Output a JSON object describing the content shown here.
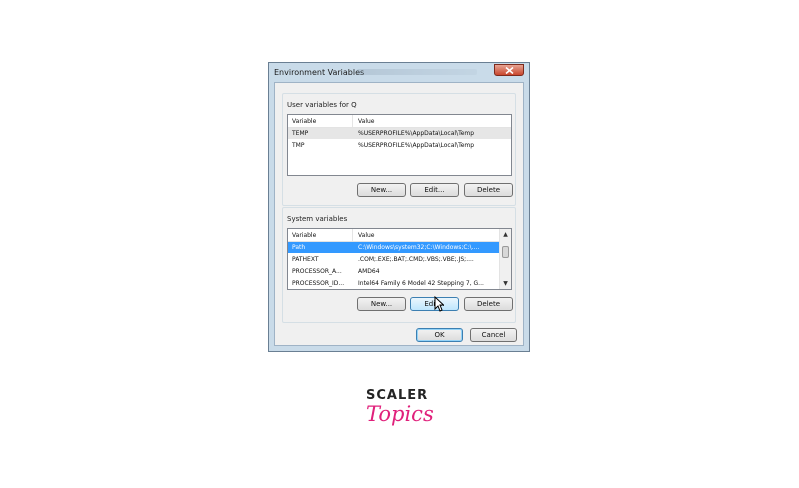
{
  "window": {
    "title": "Environment Variables"
  },
  "user_vars": {
    "group_label": "User variables for Q",
    "columns": [
      "Variable",
      "Value"
    ],
    "rows": [
      {
        "variable": "TEMP",
        "value": "%USERPROFILE%\\AppData\\Local\\Temp"
      },
      {
        "variable": "TMP",
        "value": "%USERPROFILE%\\AppData\\Local\\Temp"
      }
    ],
    "buttons": {
      "new": "New...",
      "edit": "Edit...",
      "delete": "Delete"
    }
  },
  "system_vars": {
    "group_label": "System variables",
    "columns": [
      "Variable",
      "Value"
    ],
    "rows": [
      {
        "variable": "Path",
        "value": "C:\\Windows\\system32;C:\\Windows;C:\\...."
      },
      {
        "variable": "PATHEXT",
        "value": ".COM;.EXE;.BAT;.CMD;.VBS;.VBE;.JS;...."
      },
      {
        "variable": "PROCESSOR_A...",
        "value": "AMD64"
      },
      {
        "variable": "PROCESSOR_ID...",
        "value": "Intel64 Family 6 Model 42 Stepping 7, G..."
      }
    ],
    "buttons": {
      "new": "New...",
      "edit": "Edit...",
      "delete": "Delete"
    }
  },
  "footer": {
    "ok": "OK",
    "cancel": "Cancel"
  },
  "brand": {
    "line1": "SCALER",
    "line2": "Topics"
  },
  "colors": {
    "selection": "#3399ff",
    "brand_pink": "#e0207b",
    "close_red": "#c8462d"
  },
  "icons": {
    "close": "close-icon",
    "cursor": "mouse-pointer-icon",
    "scroll_up": "scroll-up-arrow-icon",
    "scroll_down": "scroll-down-arrow-icon"
  }
}
